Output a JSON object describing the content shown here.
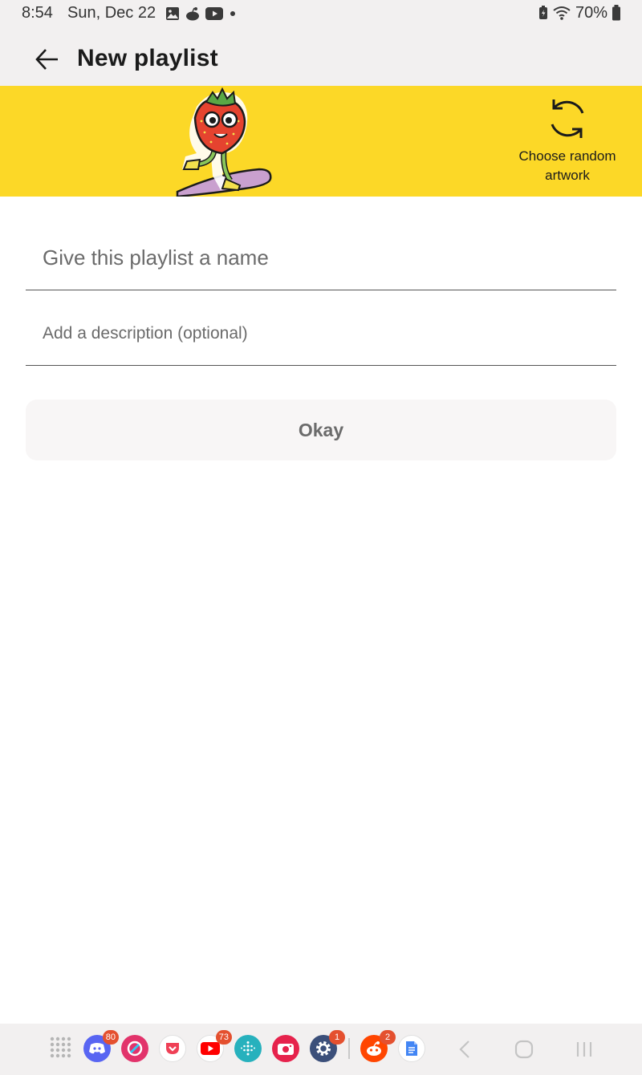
{
  "status_bar": {
    "time": "8:54",
    "date": "Sun, Dec 22",
    "battery": "70%",
    "notification_icons": [
      "gallery-icon",
      "reddit-icon",
      "youtube-icon",
      "more-dot-icon"
    ],
    "system_icons": [
      "battery-saver-icon",
      "wifi-icon",
      "battery-icon"
    ]
  },
  "header": {
    "title": "New playlist",
    "back_icon": "arrow-left-icon"
  },
  "banner": {
    "background_color": "#fcd827",
    "artwork": "strawberry-skateboarder-artwork",
    "random_button_label": "Choose random artwork",
    "random_icon": "refresh-icon"
  },
  "form": {
    "name_placeholder": "Give this playlist a name",
    "name_value": "",
    "description_placeholder": "Add a description (optional)",
    "description_value": "",
    "okay_label": "Okay"
  },
  "taskbar": {
    "apps": [
      {
        "name": "app-drawer-icon",
        "badge": ""
      },
      {
        "name": "discord-icon",
        "badge": "80",
        "color": "#5865f2"
      },
      {
        "name": "app-icon-pink",
        "badge": "",
        "color": "#e2336b"
      },
      {
        "name": "pocket-icon",
        "badge": "",
        "color": "#ef4056"
      },
      {
        "name": "youtube-icon",
        "badge": "73",
        "color": "#ff0000"
      },
      {
        "name": "fitbit-icon",
        "badge": "",
        "color": "#27b1bd"
      },
      {
        "name": "camera-app-icon",
        "badge": "",
        "color": "#e6224c"
      },
      {
        "name": "settings-icon",
        "badge": "1",
        "color": "#3b4f7a"
      },
      {
        "name": "reddit-icon",
        "badge": "2",
        "color": "#ff4500"
      },
      {
        "name": "docs-icon",
        "badge": "",
        "color": "#4285f4"
      }
    ],
    "nav": [
      "back-nav-icon",
      "home-nav-icon",
      "recents-nav-icon"
    ]
  }
}
